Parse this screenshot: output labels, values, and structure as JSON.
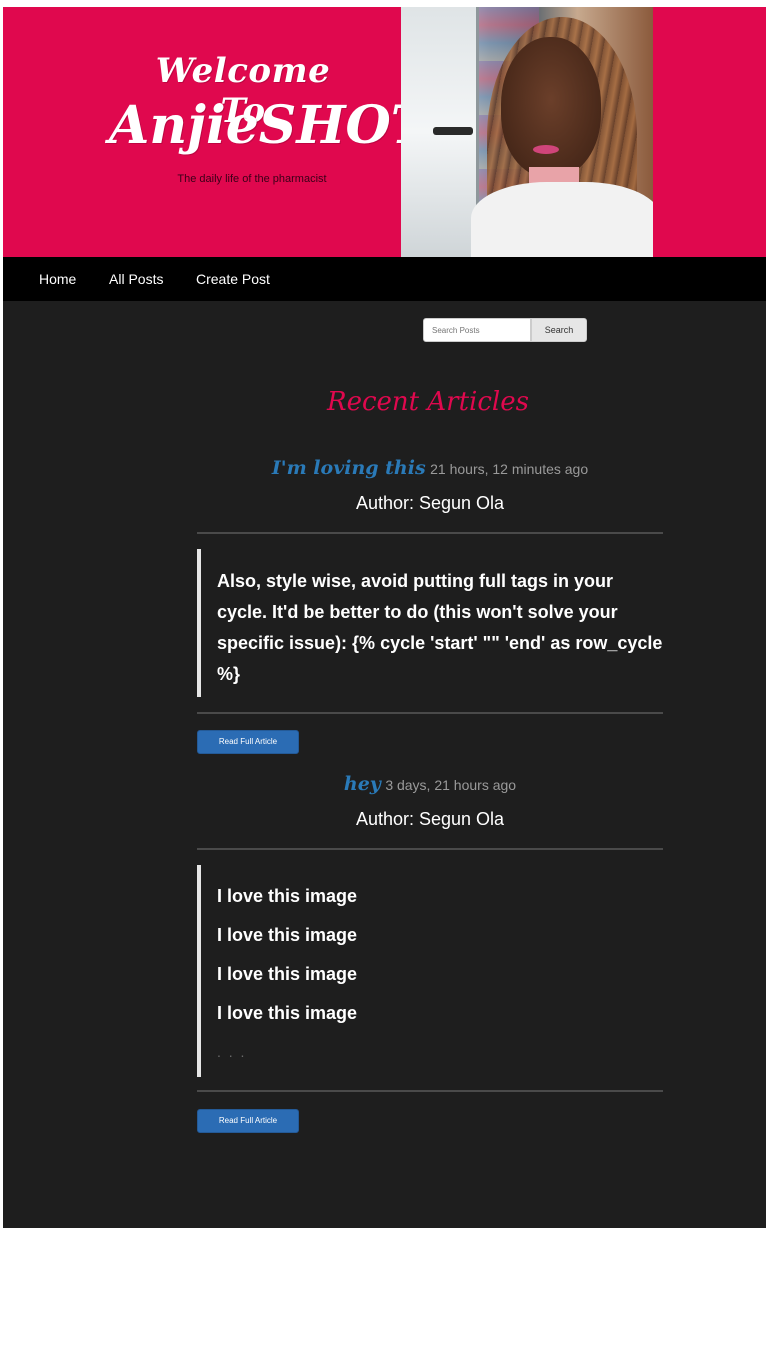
{
  "header": {
    "welcome": "Welcome To",
    "site_name": "AnjieSHOT",
    "tagline": "The daily life of the pharmacist"
  },
  "nav": {
    "items": [
      {
        "label": "Home"
      },
      {
        "label": "All Posts"
      },
      {
        "label": "Create Post"
      }
    ]
  },
  "search": {
    "placeholder": "Search Posts",
    "button_label": "Search"
  },
  "main": {
    "section_title": "Recent Articles",
    "articles": [
      {
        "title": "I'm loving this",
        "time": "21 hours, 12 minutes ago",
        "author": "Author: Segun Ola",
        "excerpt": "Also, style wise, avoid putting full tags in your cycle. It'd be better to do (this won't solve your specific issue): {% cycle 'start' \"\" 'end' as row_cycle %}",
        "read_more": "Read Full Article"
      },
      {
        "title": "hey",
        "time": "3 days, 21 hours ago",
        "author": "Author: Segun Ola",
        "excerpt_lines": [
          "I love this image",
          "I love this image",
          "I love this image",
          "I love this image"
        ],
        "ellipsis": ". . .",
        "read_more": "Read Full Article"
      }
    ]
  },
  "colors": {
    "banner": "#e0084e",
    "page_bg": "#1e1e1e",
    "nav_bg": "#000000",
    "link": "#2a7ab8",
    "button": "#2b6cb4"
  }
}
